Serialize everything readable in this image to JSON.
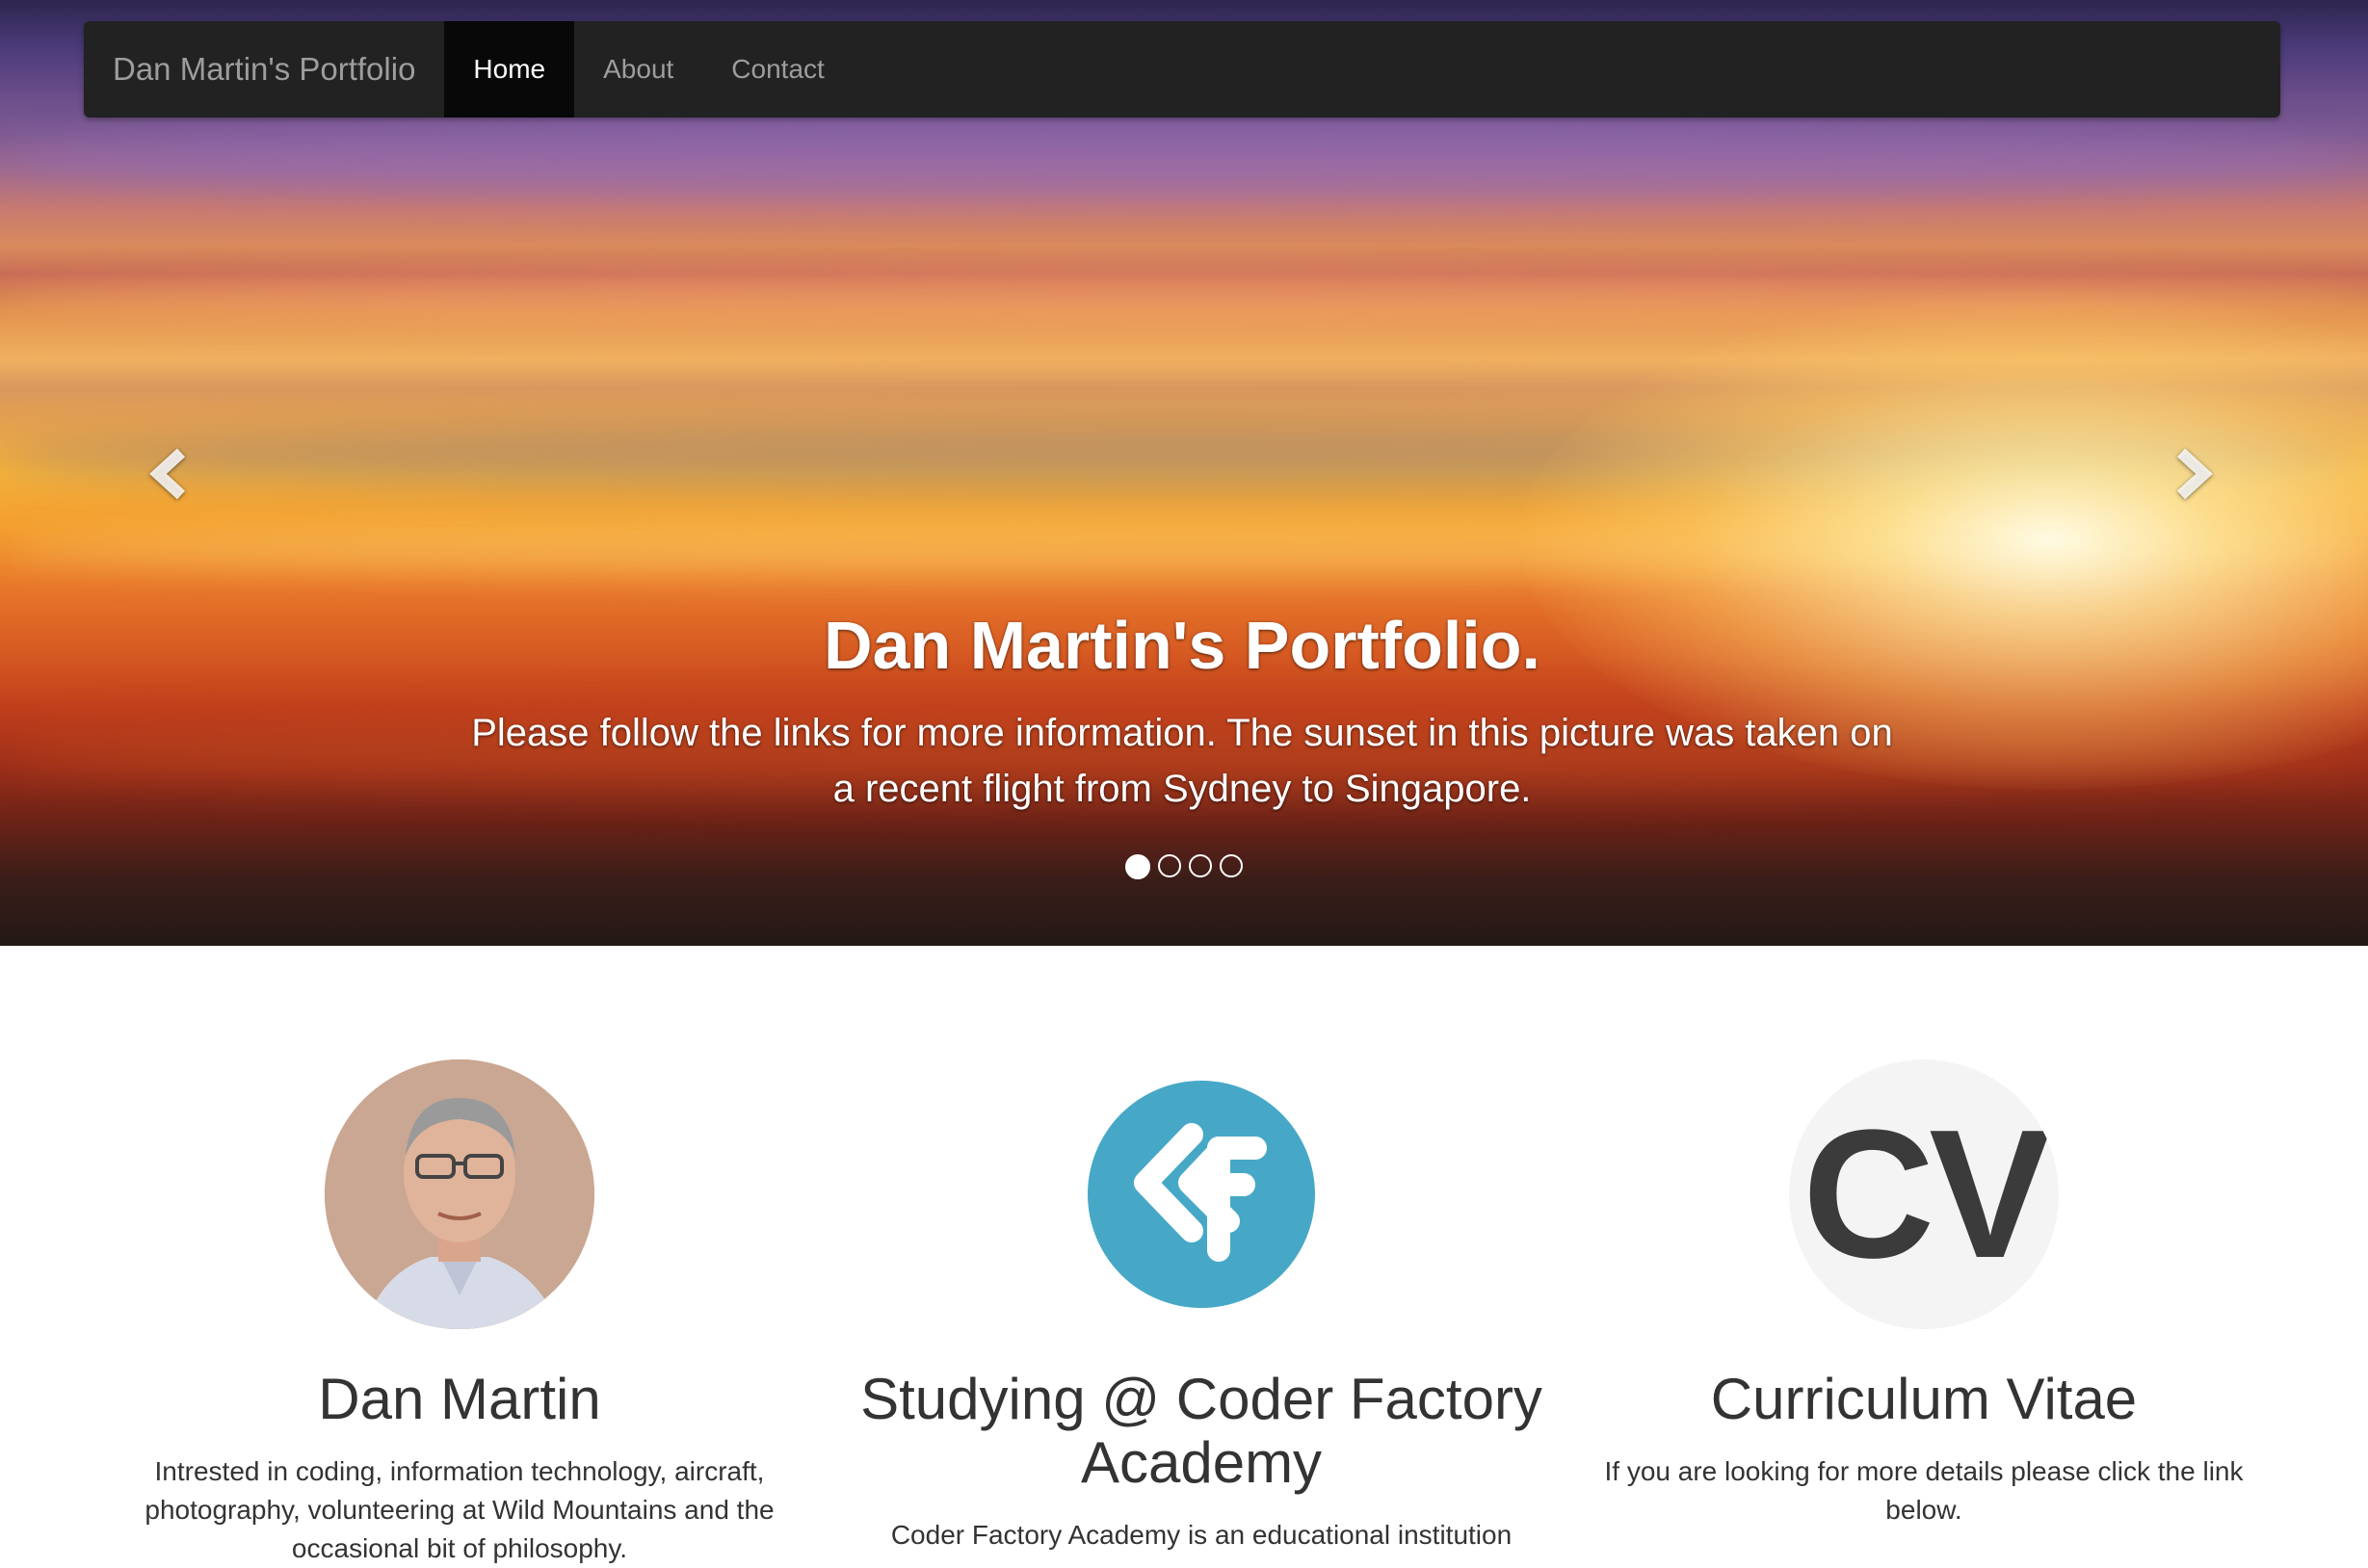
{
  "navbar": {
    "brand": "Dan Martin's Portfolio",
    "items": [
      {
        "label": "Home",
        "active": true
      },
      {
        "label": "About",
        "active": false
      },
      {
        "label": "Contact",
        "active": false
      }
    ]
  },
  "carousel": {
    "heading": "Dan Martin's Portfolio.",
    "caption": "Please follow the links for more information. The sunset in this picture was taken on a recent flight from Sydney to Singapore.",
    "slide_count": 4,
    "active_slide": 1,
    "prev_icon": "chevron-left-icon",
    "next_icon": "chevron-right-icon"
  },
  "columns": [
    {
      "image": "profile-photo",
      "heading": "Dan Martin",
      "text": "Intrested in coding, information technology, aircraft, photography, volunteering at Wild Mountains and the occasional bit of philosophy."
    },
    {
      "image": "coder-factory-logo",
      "heading": "Studying @ Coder Factory Academy",
      "text": "Coder Factory Academy is an educational institution"
    },
    {
      "image": "cv-logo",
      "image_text": "CV",
      "heading": "Curriculum Vitae",
      "text": "If you are looking for more details please click the link below."
    }
  ],
  "colors": {
    "navbar_bg": "#222222",
    "navbar_active": "#080808",
    "nav_text": "#9d9d9d",
    "cf_blue": "#46a8c6",
    "body_text": "#333333"
  }
}
